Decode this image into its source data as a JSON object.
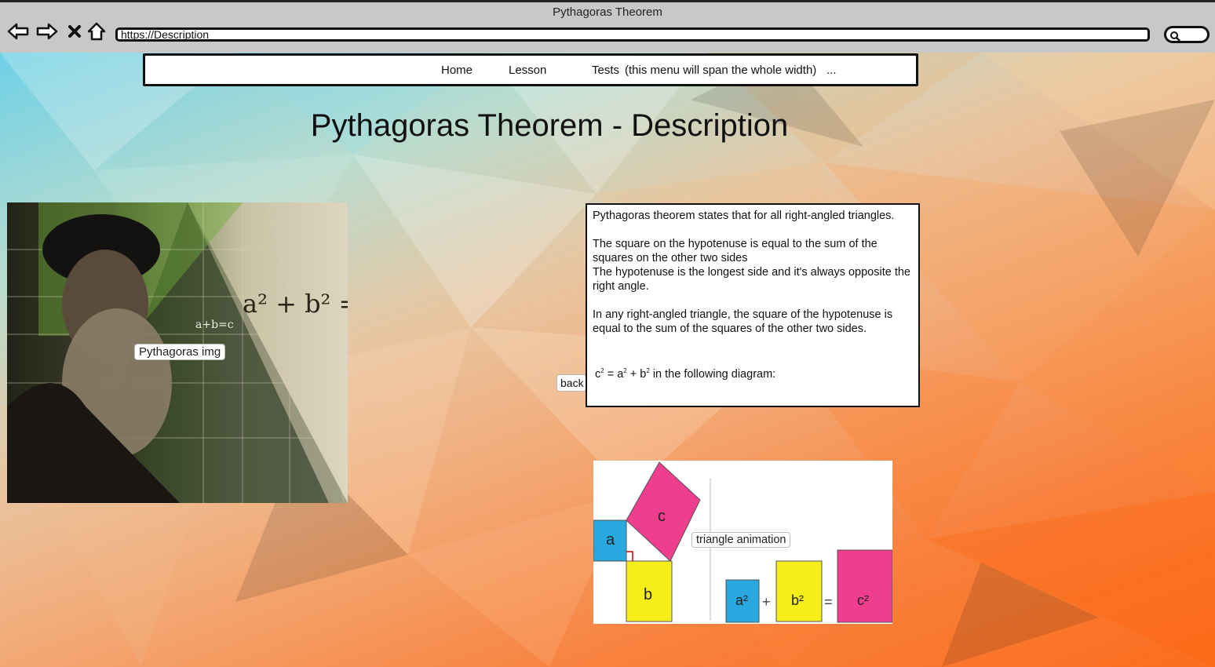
{
  "window": {
    "title": "Pythagoras Theorem"
  },
  "address_bar": {
    "url": "https://Description"
  },
  "nav": {
    "items": [
      {
        "label": "Home"
      },
      {
        "label": "Lesson"
      },
      {
        "label": "Tests"
      },
      {
        "label": "(this menu will span the whole width)"
      },
      {
        "label": "..."
      }
    ]
  },
  "page": {
    "title": "Pythagoras Theorem - Description"
  },
  "image": {
    "label": "Pythagoras img"
  },
  "description": {
    "p1": "Pythagoras theorem states that for all right-angled triangles.",
    "p2": "The square on the hypotenuse is equal to the sum of the squares on the other two sides",
    "p3": "The hypotenuse is the longest side and it's always opposite the right angle.",
    "p4": "In any right-angled triangle, the square of the hypotenuse is equal to the sum of the squares of the other two sides.",
    "formula_pre": "c",
    "formula_mid1": " = a",
    "formula_mid2": " + b",
    "formula_post": " in the following diagram:",
    "sup": "2"
  },
  "back_button": {
    "label": "back"
  },
  "diagram": {
    "label": "triangle animation",
    "side_a": "a",
    "side_b": "b",
    "side_c": "c",
    "eq_a": "a²",
    "eq_plus": "+",
    "eq_b": "b²",
    "eq_equals": "=",
    "eq_c": "c²"
  },
  "colors": {
    "square_a": "#29a8e0",
    "square_b": "#f6ee19",
    "square_c": "#ef3e8e"
  }
}
